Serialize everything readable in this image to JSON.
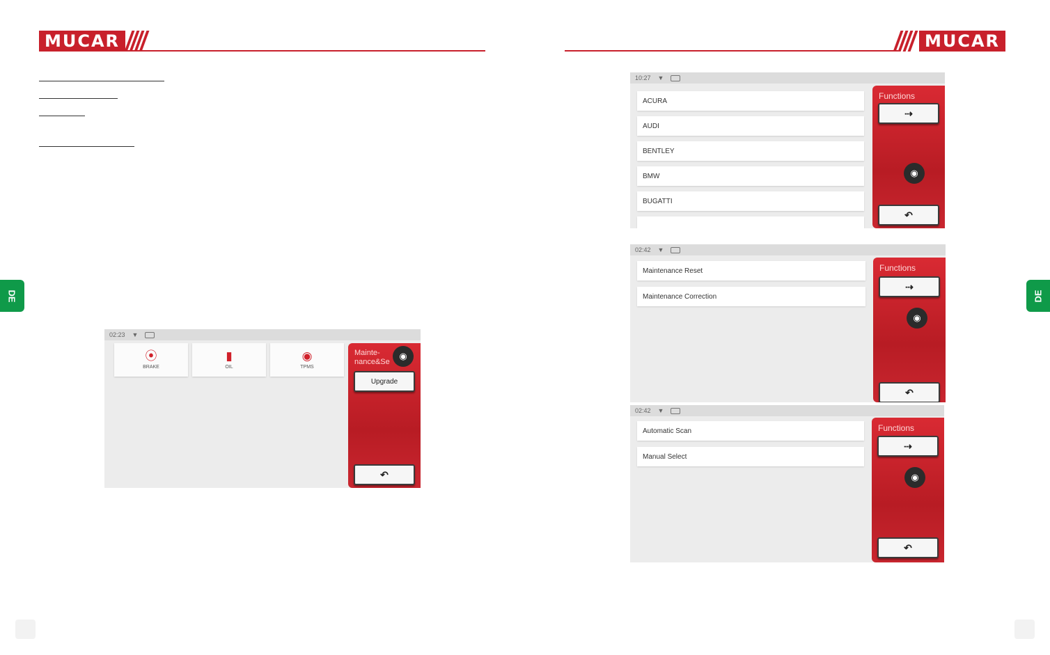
{
  "brand": "MUCAR",
  "language_tab": "DE",
  "screen_left": {
    "status_time": "02:23",
    "tiles": [
      {
        "label": "BRAKE",
        "icon": "brake-icon"
      },
      {
        "label": "OIL",
        "icon": "oil-icon"
      },
      {
        "label": "TPMS",
        "icon": "tpms-icon"
      }
    ],
    "panel_title": "Mainte-nance&Se",
    "upgrade_label": "Upgrade"
  },
  "screen_brands": {
    "status_time": "10:27",
    "items": [
      "ACURA",
      "AUDI",
      "BENTLEY",
      "BMW",
      "BUGATTI"
    ],
    "panel_title": "Functions"
  },
  "screen_maintenance": {
    "status_time": "02:42",
    "items": [
      "Maintenance Reset",
      "Maintenance Correction"
    ],
    "panel_title": "Functions"
  },
  "screen_scan": {
    "status_time": "02:42",
    "items": [
      "Automatic Scan",
      "Manual Select"
    ],
    "panel_title": "Functions"
  },
  "icons": {
    "exit": "exit-icon",
    "back": "back-icon",
    "camera": "camera-icon",
    "wifi": "wifi-icon",
    "battery": "battery-icon"
  },
  "colors": {
    "brand_red": "#c8202b",
    "tab_green": "#0f9a49"
  }
}
